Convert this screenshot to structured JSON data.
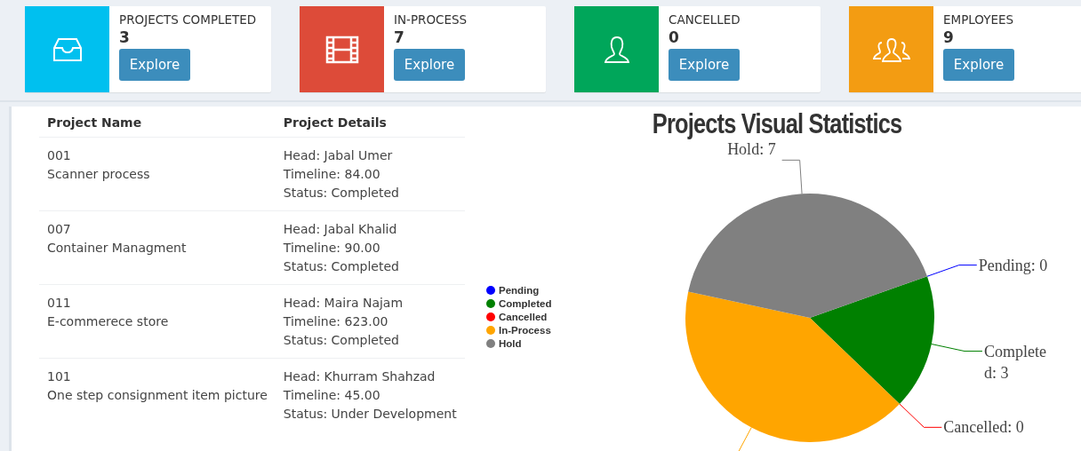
{
  "stat_cards": [
    {
      "title": "PROJECTS COMPLETED",
      "count": "3",
      "button": "Explore",
      "color": "#00c0ef",
      "kind": "tray"
    },
    {
      "title": "IN-PROCESS",
      "count": "7",
      "button": "Explore",
      "color": "#dd4b39",
      "kind": "film"
    },
    {
      "title": "CANCELLED",
      "count": "0",
      "button": "Explore",
      "color": "#00a65a",
      "kind": "user"
    },
    {
      "title": "EMPLOYEES",
      "count": "9",
      "button": "Explore",
      "color": "#f39c12",
      "kind": "users"
    }
  ],
  "projects_table": {
    "columns": [
      "Project Name",
      "Project Details"
    ],
    "rows": [
      {
        "id": "001",
        "name": "Scanner process",
        "details": [
          "Head: Jabal Umer",
          "Timeline: 84.00",
          "Status: Completed"
        ]
      },
      {
        "id": "007",
        "name": "Container Managment",
        "details": [
          "Head: Jabal Khalid",
          "Timeline: 90.00",
          "Status: Completed"
        ]
      },
      {
        "id": "011",
        "name": "E-commerece store",
        "details": [
          "Head: Maira Najam",
          "Timeline: 623.00",
          "Status: Completed"
        ]
      },
      {
        "id": "101",
        "name": "One step consignment item picture",
        "details": [
          "Head: Khurram Shahzad",
          "Timeline: 45.00",
          "Status: Under Development"
        ]
      }
    ]
  },
  "chart": {
    "chart_data": {
      "type": "pie",
      "title": "Projects Visual Statistics",
      "categories": [
        "Pending",
        "Completed",
        "Cancelled",
        "In-Process",
        "Hold"
      ],
      "values": [
        0,
        17.6,
        0,
        41.2,
        41.2
      ],
      "colors": [
        "#0000ff",
        "#008000",
        "#ff0000",
        "#ffa500",
        "#808080"
      ],
      "legend": true,
      "annotations": [
        {
          "x": "Hold",
          "text": "Hold: 7"
        },
        {
          "x": "Pending",
          "text": "Pending: 0"
        },
        {
          "x": "Completed",
          "text": "Completed: 3"
        },
        {
          "x": "Cancelled",
          "text": "Cancelled: 0"
        }
      ]
    }
  }
}
